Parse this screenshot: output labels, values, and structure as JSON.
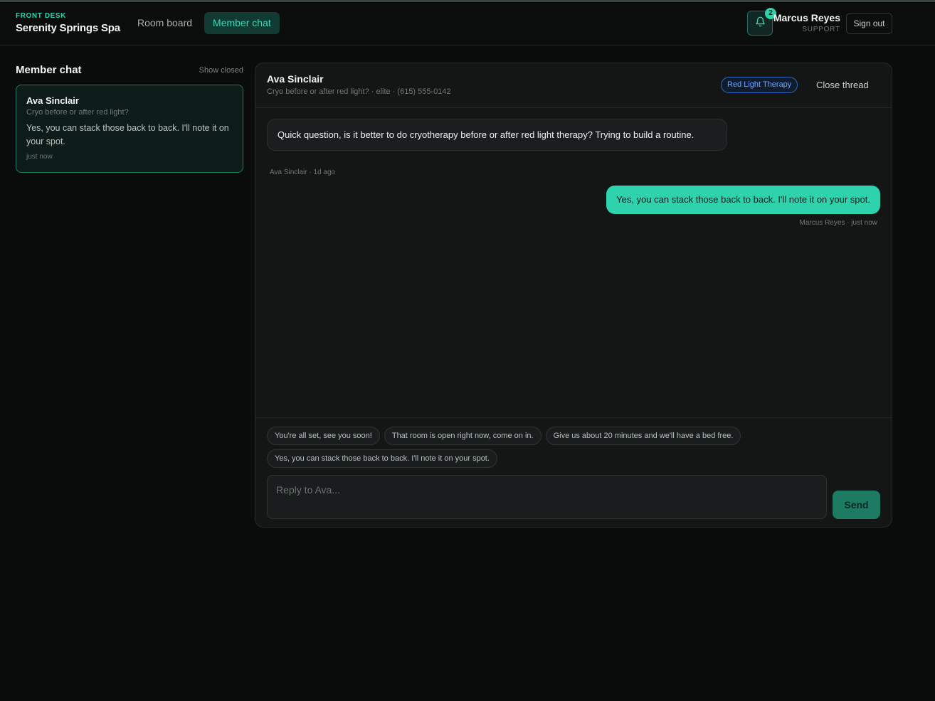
{
  "header": {
    "kicker": "FRONT DESK",
    "brand": "Serenity Springs Spa",
    "nav": [
      {
        "label": "Room board"
      },
      {
        "label": "Member chat"
      }
    ],
    "notifications_count": "2",
    "user_name": "Marcus Reyes",
    "user_role": "SUPPORT",
    "sign_out": "Sign out"
  },
  "sidebar": {
    "title": "Member chat",
    "show_closed": "Show closed",
    "threads": [
      {
        "name": "Ava Sinclair",
        "subject": "Cryo before or after red light?",
        "preview": "Yes, you can stack those back to back. I'll note it on your spot.",
        "time": "just now"
      }
    ]
  },
  "thread": {
    "name": "Ava Sinclair",
    "meta": "Cryo before or after red light? · elite · (615) 555-0142",
    "tag": "Red Light Therapy",
    "close_label": "Close thread",
    "messages": [
      {
        "text": "Quick question, is it better to do cryotherapy before or after red light therapy? Trying to build a routine.",
        "meta": "Ava Sinclair · 1d ago"
      },
      {
        "text": "Yes, you can stack those back to back. I'll note it on your spot.",
        "meta": "Marcus Reyes · just now"
      }
    ]
  },
  "composer": {
    "quick_replies": [
      "You're all set, see you soon!",
      "That room is open right now, come on in.",
      "Give us about 20 minutes and we'll have a bed free.",
      "Yes, you can stack those back to back. I'll note it on your spot."
    ],
    "placeholder": "Reply to Ava...",
    "send_label": "Send"
  },
  "colors": {
    "accent": "#2ed3ae",
    "background": "#0a0b0b",
    "panel": "#141616",
    "tag_blue": "#6fa6ff"
  },
  "icons": {
    "bell": "bell-icon"
  }
}
